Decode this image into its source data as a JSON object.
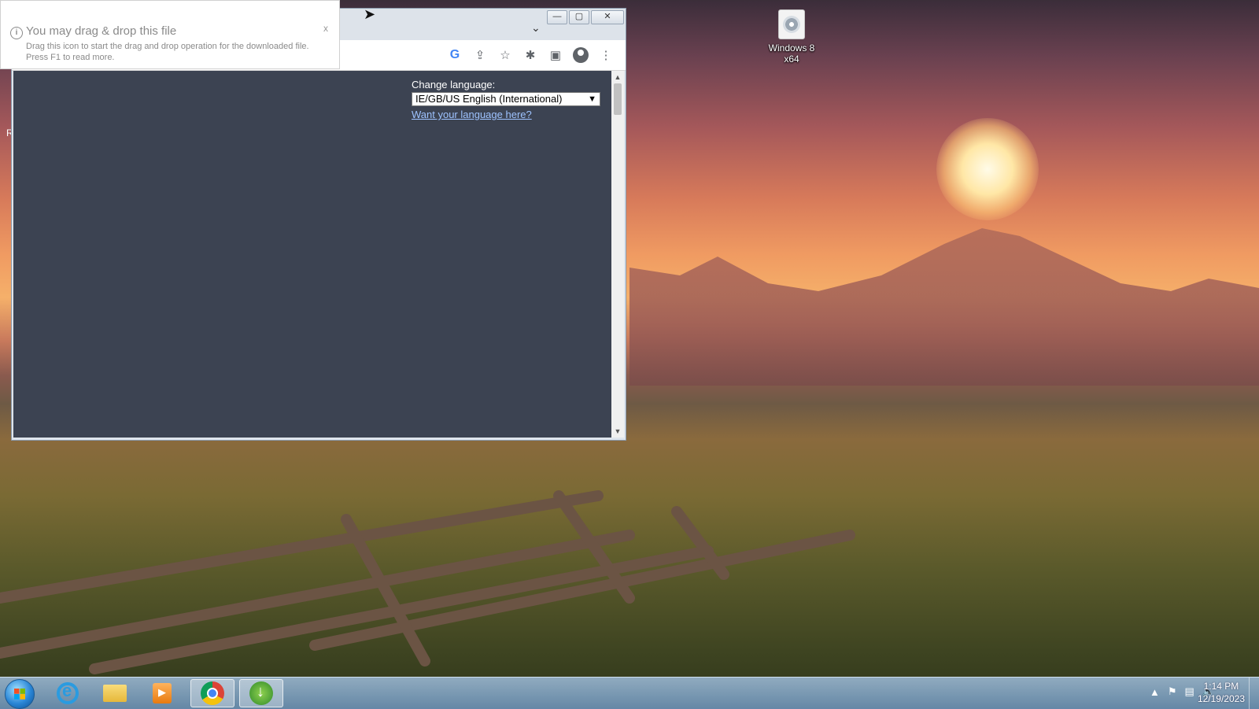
{
  "desktop": {
    "icons": [
      {
        "label_line1": "Windows 8",
        "label_line2": "x64"
      }
    ],
    "edge_char": "R"
  },
  "notification": {
    "title": "You may drag & drop this file",
    "line1": "Drag this icon to start the drag and drop operation for the downloaded file.",
    "line2": "Press F1 to read more.",
    "close": "x"
  },
  "browser": {
    "window_buttons": {
      "minimize": "—",
      "maximize": "▢",
      "close": "✕"
    },
    "tab_chevron": "⌄",
    "toolbar_icons": [
      "google-icon",
      "share-icon",
      "star-icon",
      "extensions-icon",
      "side-panel-icon",
      "profile-icon",
      "menu-icon"
    ],
    "google_glyph": "G",
    "language": {
      "label": "Change language:",
      "selected": "IE/GB/US English (International)",
      "link": "Want your language here?"
    }
  },
  "taskbar": {
    "items": [
      "start",
      "internet-explorer",
      "file-explorer",
      "media-player",
      "chrome",
      "internet-download-manager"
    ],
    "clock_time": "1:14 PM",
    "clock_date": "12/19/2023"
  }
}
